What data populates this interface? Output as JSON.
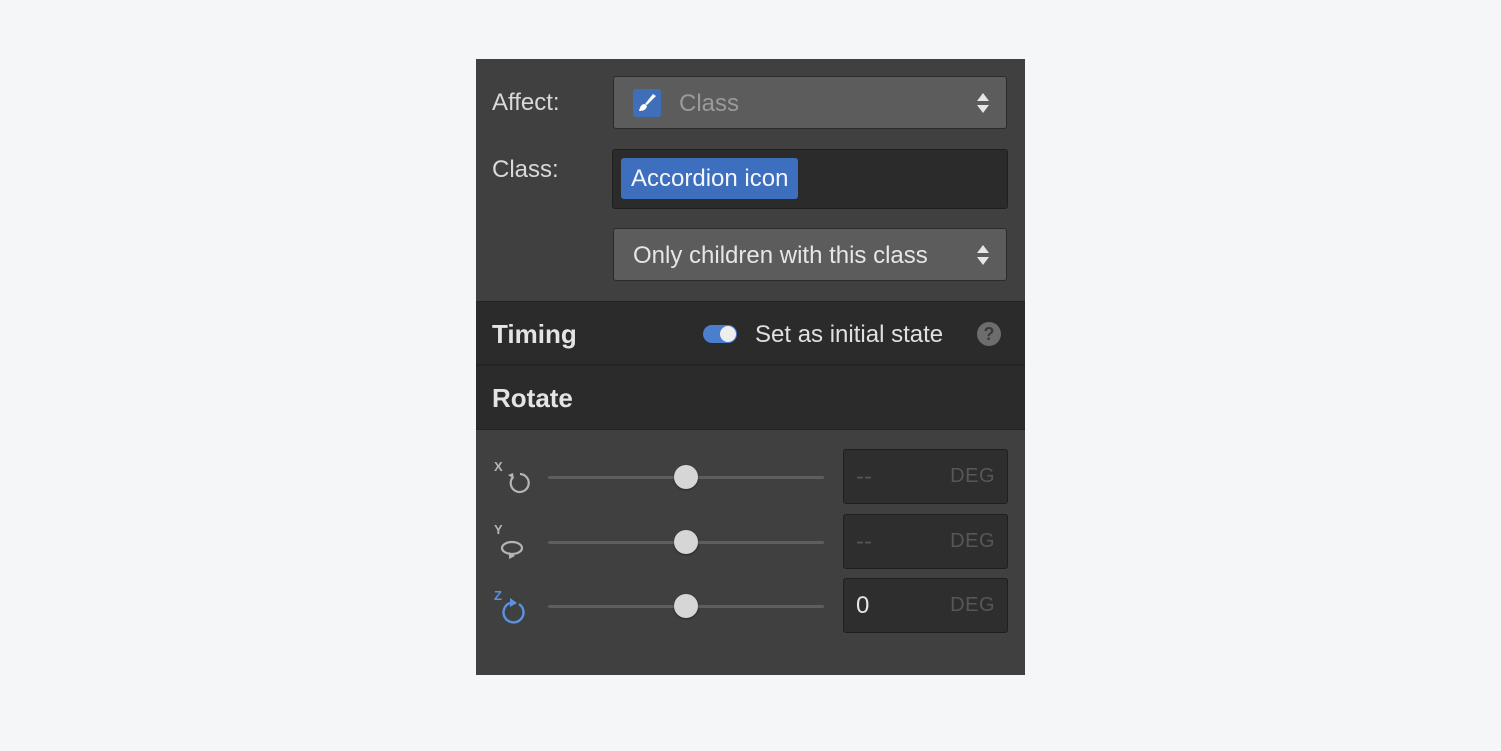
{
  "affect": {
    "label": "Affect:",
    "icon": "brush-icon",
    "value": "Class"
  },
  "class_field": {
    "label": "Class:",
    "chip": "Accordion icon"
  },
  "scope": {
    "value": "Only children with this class"
  },
  "timing": {
    "title": "Timing",
    "toggle_on": true,
    "toggle_label": "Set as initial state",
    "help": "?"
  },
  "rotate": {
    "title": "Rotate",
    "rows": [
      {
        "axis": "X",
        "icon": "rotate-x-icon",
        "value": "--",
        "unit": "DEG",
        "slider_level": 0.5
      },
      {
        "axis": "Y",
        "icon": "rotate-y-icon",
        "value": "--",
        "unit": "DEG",
        "slider_level": 0.5
      },
      {
        "axis": "Z",
        "icon": "rotate-z-icon",
        "value": "0",
        "unit": "DEG",
        "slider_level": 0.5
      }
    ]
  },
  "colors": {
    "panel": "#404040",
    "accent": "#3d6fbe",
    "background": "#f5f6f8"
  }
}
